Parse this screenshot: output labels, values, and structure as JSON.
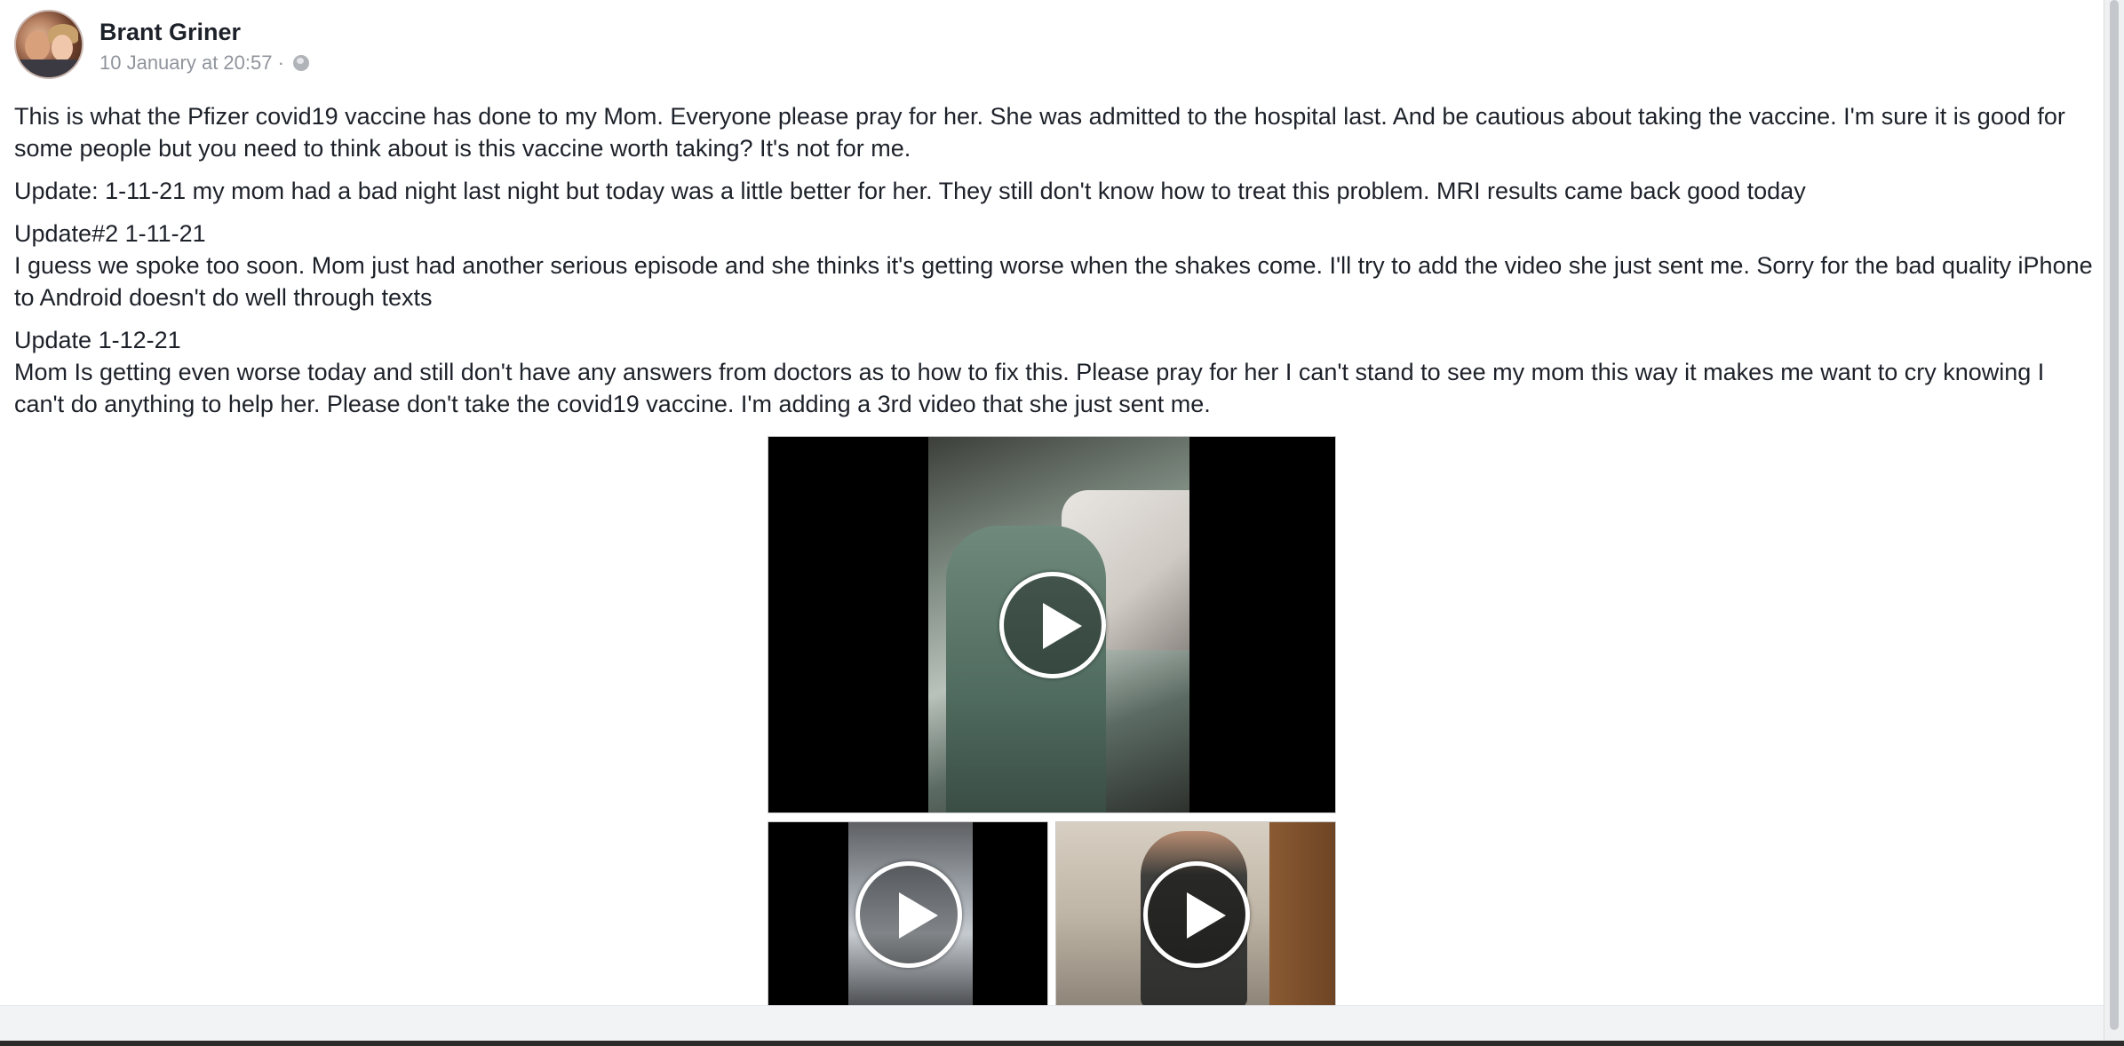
{
  "post": {
    "author": "Brant Griner",
    "timestamp": "10 January at 20:57 ·",
    "privacy_icon": "globe-icon",
    "paragraphs": [
      "This is what the Pfizer covid19 vaccine has done to my Mom. Everyone please pray for her. She was admitted to the hospital last. And be cautious about taking the vaccine. I'm sure it is good for some people but you need to think about is this vaccine worth taking? It's not for me.",
      "Update: 1-11-21 my mom had a bad night last night but today was a little better for her. They still don't know how to treat this problem. MRI results came back good today",
      "Update#2 1-11-21",
      "I guess we spoke too soon. Mom just had another serious episode and she thinks it's getting worse when the shakes come. I'll try to add the video she just sent me. Sorry for the bad quality iPhone to Android doesn't do well through texts",
      "Update 1-12-21",
      "Mom Is getting even worse today and still don't have any answers from doctors as to how to fix this. Please pray for her I can't stand to see my mom this way it makes me want to cry knowing I can't do anything to help her. Please don't take the covid19 vaccine. I'm adding a 3rd video that she just sent me."
    ],
    "media": {
      "videos": [
        {
          "icon": "play-icon"
        },
        {
          "icon": "play-icon"
        },
        {
          "icon": "play-icon"
        }
      ]
    }
  }
}
